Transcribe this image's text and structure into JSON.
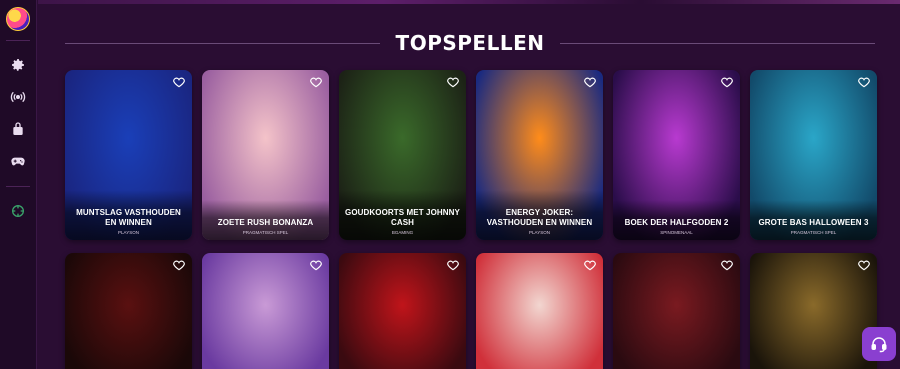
{
  "section": {
    "title": "TOPSPELLEN"
  },
  "sidebar": {
    "items": [
      {
        "name": "settings-icon"
      },
      {
        "name": "live-icon"
      },
      {
        "name": "promotions-icon"
      },
      {
        "name": "gamepad-icon"
      },
      {
        "name": "sports-icon"
      }
    ]
  },
  "games_row1": [
    {
      "title": "MUNTSLAG VASTHOUDEN EN WINNEN",
      "provider": "PLAYSON",
      "colors": [
        "#1a3fb8",
        "#1a2580"
      ]
    },
    {
      "title": "ZOETE RUSH BONANZA",
      "provider": "PRAGMATISCH SPEL",
      "colors": [
        "#f4c3c9",
        "#9a5fa0"
      ]
    },
    {
      "title": "GOUDKOORTS MET JOHNNY CASH",
      "provider": "BGAMING",
      "colors": [
        "#3a6a2a",
        "#1c2216"
      ]
    },
    {
      "title": "ENERGY JOKER: VASTHOUDEN EN WINNEN",
      "provider": "PLAYSON",
      "colors": [
        "#ff8c1a",
        "#1a2a80"
      ]
    },
    {
      "title": "BOEK DER HALFGODEN 2",
      "provider": "SPINOMENAAL",
      "colors": [
        "#b83ad0",
        "#2a0d4a"
      ]
    },
    {
      "title": "GROTE BAS HALLOWEEN 3",
      "provider": "PRAGMATISCH SPEL",
      "colors": [
        "#2aa6c8",
        "#124a6a"
      ]
    }
  ],
  "games_row2": [
    {
      "colors": [
        "#5a1010",
        "#1a0808"
      ]
    },
    {
      "colors": [
        "#c99ad6",
        "#6a3aa0"
      ]
    },
    {
      "colors": [
        "#c0141a",
        "#3a0a10"
      ]
    },
    {
      "colors": [
        "#f2d6d0",
        "#d0303a"
      ]
    },
    {
      "colors": [
        "#7a1a20",
        "#2a0a10"
      ]
    },
    {
      "colors": [
        "#8a6a2a",
        "#1a140a"
      ]
    }
  ],
  "support": {
    "name": "headset-icon"
  }
}
